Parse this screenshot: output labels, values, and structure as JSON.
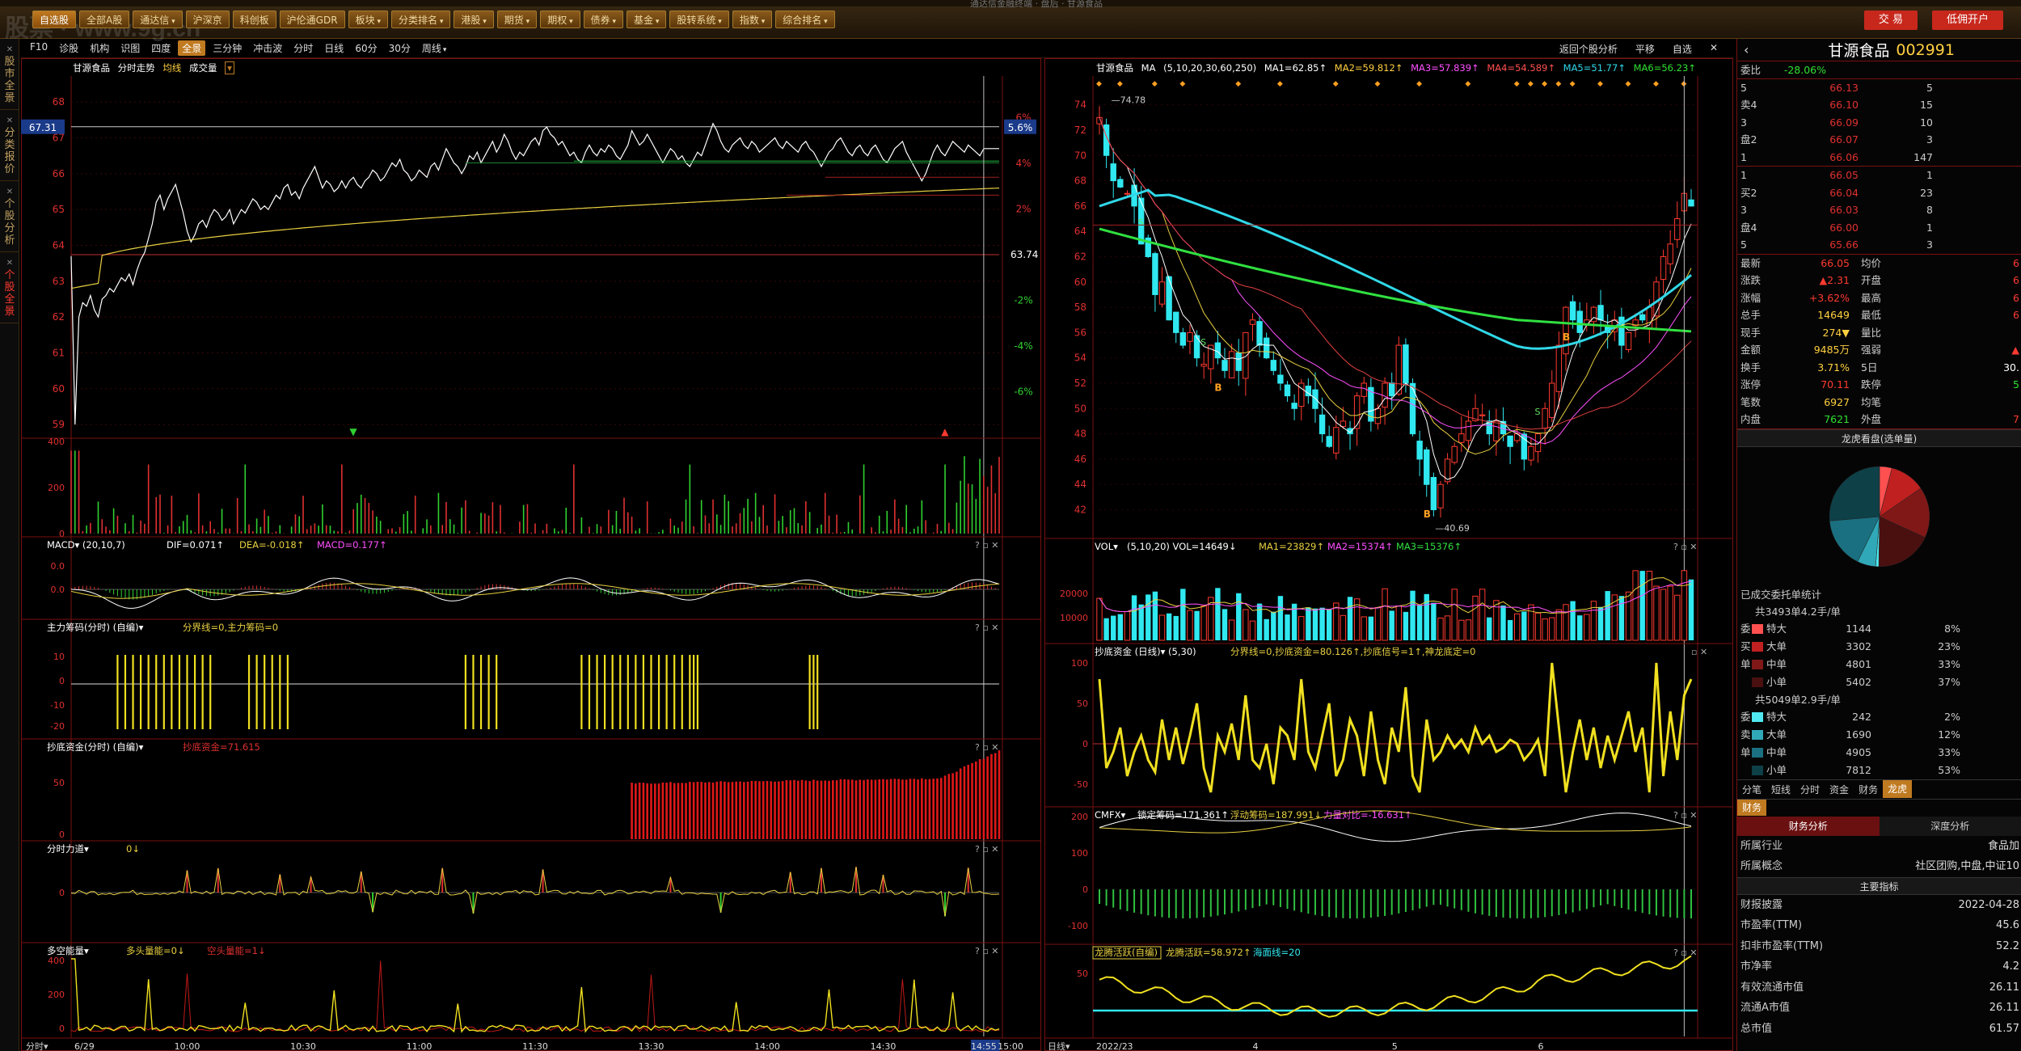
{
  "app": {
    "brand": "股票 · www.9g.cn",
    "title": "通达信金融终端 · 盘后 · 甘源食品"
  },
  "menu": [
    {
      "label": "自选股",
      "arrow": false,
      "active": true
    },
    {
      "label": "全部A股",
      "arrow": false
    },
    {
      "label": "通达信",
      "arrow": true
    },
    {
      "label": "沪深京",
      "arrow": false
    },
    {
      "label": "科创板",
      "arrow": false
    },
    {
      "label": "沪伦通GDR",
      "arrow": false
    },
    {
      "label": "板块",
      "arrow": true
    },
    {
      "label": "分类排名",
      "arrow": true
    },
    {
      "label": "港股",
      "arrow": true
    },
    {
      "label": "期货",
      "arrow": true
    },
    {
      "label": "期权",
      "arrow": true
    },
    {
      "label": "债券",
      "arrow": true
    },
    {
      "label": "基金",
      "arrow": true
    },
    {
      "label": "股转系统",
      "arrow": true
    },
    {
      "label": "指数",
      "arrow": true
    },
    {
      "label": "综合排名",
      "arrow": true
    }
  ],
  "trade_buttons": [
    "交 易",
    "低佣开户"
  ],
  "left_tabs": [
    {
      "label": "股市全景",
      "active": false
    },
    {
      "label": "分类报价",
      "active": false
    },
    {
      "label": "个股分析",
      "active": false
    },
    {
      "label": "个股全景",
      "active": true
    }
  ],
  "toolbar2": {
    "left": [
      {
        "label": "F10"
      },
      {
        "label": "诊股"
      },
      {
        "label": "机构"
      },
      {
        "label": "识图"
      },
      {
        "label": "四度"
      },
      {
        "label": "全景",
        "sel": true
      },
      {
        "label": "三分钟"
      },
      {
        "label": "冲击波"
      },
      {
        "label": "分时"
      },
      {
        "label": "日线"
      },
      {
        "label": "60分"
      },
      {
        "label": "30分"
      },
      {
        "label": "周线",
        "drop": true
      }
    ],
    "right": [
      "返回个股分析",
      "平移",
      "自选",
      "✕"
    ]
  },
  "intraday": {
    "header": {
      "name": "甘源食品",
      "mode": "分时走势",
      "avg": "均线",
      "vol": "成交量"
    },
    "price_ticks": [
      "68",
      "67",
      "66",
      "65",
      "64",
      "63",
      "62",
      "61",
      "60",
      "59"
    ],
    "pct_ticks": [
      "6%",
      "4%",
      "2%",
      "-2%",
      "-4%",
      "-6%"
    ],
    "price_box": "67.31",
    "pct_box": "5.6%",
    "last_label": "63.74",
    "time_labels": [
      "6/29",
      "10:00",
      "10:30",
      "11:00",
      "11:30",
      "13:30",
      "14:00",
      "14:30",
      "14:55",
      "15:00"
    ],
    "bottom_left": "分时",
    "vol_ticks": [
      "400",
      "200",
      "0"
    ]
  },
  "macd_intraday": {
    "title": "MACD",
    "params": "(20,10,7)",
    "dif": "DIF=0.071↑",
    "dea": "DEA=-0.018↑",
    "macd": "MACD=0.177↑",
    "ticks": [
      "0.0",
      "0.0"
    ]
  },
  "zhuli": {
    "title": "主力筹码(分时)",
    "flag": "(自编)",
    "text": "分界线=0,主力筹码=0",
    "ticks": [
      "10",
      "0",
      "-10",
      "-20"
    ]
  },
  "chaodi_intraday": {
    "title": "抄底资金(分时)",
    "flag": "(自编)",
    "text": "抄底资金=71.615",
    "ticks": [
      "50",
      "0"
    ]
  },
  "lidao": {
    "title": "分时力道",
    "text": "0↓",
    "ticks": [
      "0"
    ]
  },
  "duokong": {
    "title": "多空能量",
    "text1": "多头量能=0↓",
    "text2": "空头量能=1↓",
    "ticks": [
      "400",
      "200",
      "0"
    ]
  },
  "daily": {
    "header": {
      "name": "甘源食品",
      "ma": "MA",
      "params": "(5,10,20,30,60,250)",
      "ma1": "MA1=62.85↑",
      "ma2": "MA2=59.812↑",
      "ma3": "MA3=57.839↑",
      "ma4": "MA4=54.589↑",
      "ma5": "MA5=51.77↑",
      "ma6": "MA6=56.23↑"
    },
    "price_ticks": [
      "74",
      "72",
      "70",
      "68",
      "66",
      "64",
      "62",
      "60",
      "58",
      "56",
      "54",
      "52",
      "50",
      "48",
      "46",
      "44",
      "42"
    ],
    "high_label": "74.78",
    "low_label": "40.69",
    "date_labels": [
      "2022/2",
      "3",
      "4",
      "5",
      "6"
    ],
    "bottom_left": "日线"
  },
  "vol_daily": {
    "title": "VOL",
    "params": "(5,10,20)",
    "vol": "VOL=14649↓",
    "ma1": "MA1=23829↑",
    "ma2": "MA2=15374↑",
    "ma3": "MA3=15376↑",
    "ticks": [
      "20000",
      "10000"
    ]
  },
  "chaodi_daily": {
    "title": "抄底资金 (日线)",
    "params": "(5,30)",
    "text": "分界线=0,抄底资金=80.126↑,抄底信号=1↑,神龙底定=0",
    "ticks": [
      "100",
      "50",
      "0",
      "-50"
    ]
  },
  "cmfx": {
    "title": "CMFX",
    "a": "锁定筹码=171.361↑",
    "b": "浮动筹码=187.991↓",
    "c": "力量对比=-16.631↑",
    "ticks": [
      "200",
      "100",
      "0",
      "-100"
    ]
  },
  "longteng": {
    "title": "龙腾活跃(自编)",
    "a": "龙腾活跃=58.972↑",
    "b": "海面线=20",
    "ticks": [
      "50"
    ]
  },
  "quote": {
    "name": "甘源食品",
    "code": "002991",
    "weibi_label": "委比",
    "weibi": "-28.06%",
    "sell": [
      {
        "lv": "5",
        "p": "66.13",
        "v": "5"
      },
      {
        "lv": "4",
        "p": "66.10",
        "v": "15"
      },
      {
        "lv": "3",
        "p": "66.09",
        "v": "10"
      },
      {
        "lv": "2",
        "p": "66.07",
        "v": "3"
      },
      {
        "lv": "1",
        "p": "66.06",
        "v": "147"
      }
    ],
    "buy": [
      {
        "lv": "1",
        "p": "66.05",
        "v": "1"
      },
      {
        "lv": "2",
        "p": "66.04",
        "v": "23"
      },
      {
        "lv": "3",
        "p": "66.03",
        "v": "8"
      },
      {
        "lv": "4",
        "p": "66.00",
        "v": "1"
      },
      {
        "lv": "5",
        "p": "65.66",
        "v": "3"
      }
    ],
    "sell_side": "卖",
    "buy_side": "买",
    "pan": "盘",
    "stats": [
      {
        "k": "最新",
        "v": "66.05",
        "vc": "red",
        "k2": "均价",
        "v2": "6",
        "v2c": "red"
      },
      {
        "k": "涨跌",
        "v": "▲2.31",
        "vc": "red",
        "k2": "开盘",
        "v2": "6",
        "v2c": "red"
      },
      {
        "k": "涨幅",
        "v": "+3.62%",
        "vc": "red",
        "k2": "最高",
        "v2": "6",
        "v2c": "red"
      },
      {
        "k": "总手",
        "v": "14649",
        "vc": "yellow",
        "k2": "最低",
        "v2": "6",
        "v2c": "red"
      },
      {
        "k": "现手",
        "v": "274▼",
        "vc": "yellow",
        "k2": "量比",
        "v2": "",
        "v2c": "white"
      },
      {
        "k": "金额",
        "v": "9485万",
        "vc": "yellow",
        "k2": "强弱",
        "v2": "▲",
        "v2c": "red"
      },
      {
        "k": "换手",
        "v": "3.71%",
        "vc": "yellow",
        "k2": "5日",
        "v2": "30.",
        "v2c": "white"
      },
      {
        "k": "涨停",
        "v": "70.11",
        "vc": "red",
        "k2": "跌停",
        "v2": "5",
        "v2c": "green"
      },
      {
        "k": "笔数",
        "v": "6927",
        "vc": "yellow",
        "k2": "均笔",
        "v2": "",
        "v2c": "white"
      },
      {
        "k": "内盘",
        "v": "7621",
        "vc": "green",
        "k2": "外盘",
        "v2": "7",
        "v2c": "red"
      }
    ],
    "pie_title": "龙虎看盘(选单量)",
    "pie_slices": [
      {
        "value": 8,
        "color": "#ff5050"
      },
      {
        "value": 23,
        "color": "#c02020"
      },
      {
        "value": 33,
        "color": "#801818"
      },
      {
        "value": 37,
        "color": "#4a1010"
      },
      {
        "value": 2,
        "color": "#50e8f0"
      },
      {
        "value": 12,
        "color": "#30a8b8"
      },
      {
        "value": 33,
        "color": "#1a7080"
      },
      {
        "value": 53,
        "color": "#0e4048"
      }
    ],
    "orders_title": "已成交委托单统计",
    "buy_group": {
      "head": "共3493单4.2手/单",
      "rows": [
        {
          "s": "委",
          "lbl": "特大",
          "n": "1144",
          "p": "8%",
          "c": "#ff5050"
        },
        {
          "s": "买",
          "lbl": "大单",
          "n": "3302",
          "p": "23%",
          "c": "#c02020"
        },
        {
          "s": "单",
          "lbl": "中单",
          "n": "4801",
          "p": "33%",
          "c": "#801818"
        },
        {
          "s": "",
          "lbl": "小单",
          "n": "5402",
          "p": "37%",
          "c": "#4a1010"
        }
      ]
    },
    "sell_group": {
      "head": "共5049单2.9手/单",
      "rows": [
        {
          "s": "委",
          "lbl": "特大",
          "n": "242",
          "p": "2%",
          "c": "#50e8f0"
        },
        {
          "s": "卖",
          "lbl": "大单",
          "n": "1690",
          "p": "12%",
          "c": "#30a8b8"
        },
        {
          "s": "单",
          "lbl": "中单",
          "n": "4905",
          "p": "33%",
          "c": "#1a7080"
        },
        {
          "s": "",
          "lbl": "小单",
          "n": "7812",
          "p": "53%",
          "c": "#0e4048"
        }
      ]
    },
    "bottom_tabs": [
      {
        "label": "分笔"
      },
      {
        "label": "短线"
      },
      {
        "label": "分时"
      },
      {
        "label": "资金"
      },
      {
        "label": "财务"
      },
      {
        "label": "龙虎",
        "sel": true
      }
    ],
    "fin_tab": "财务",
    "fin_subtabs": [
      "财务分析",
      "深度分析"
    ],
    "fin_rows1": [
      {
        "k": "所属行业",
        "v": "食品加"
      },
      {
        "k": "所属概念",
        "v": "社区团购,中盘,中证10"
      }
    ],
    "fin_section": "主要指标",
    "fin_rows2": [
      {
        "k": "财报披露",
        "v": "2022-04-28"
      },
      {
        "k": "市盈率(TTM)",
        "v": "45.6"
      },
      {
        "k": "扣非市盈率(TTM)",
        "v": "52.2"
      },
      {
        "k": "市净率",
        "v": "4.2"
      },
      {
        "k": "有效流通市值",
        "v": "26.11"
      },
      {
        "k": "流通A市值",
        "v": "26.11"
      },
      {
        "k": "总市值",
        "v": "61.57"
      }
    ]
  },
  "colors": {
    "up": "#ff3a30",
    "down": "#30e8f0",
    "bg": "#000000",
    "grid": "#7a1010",
    "accent": "#c07a20"
  }
}
